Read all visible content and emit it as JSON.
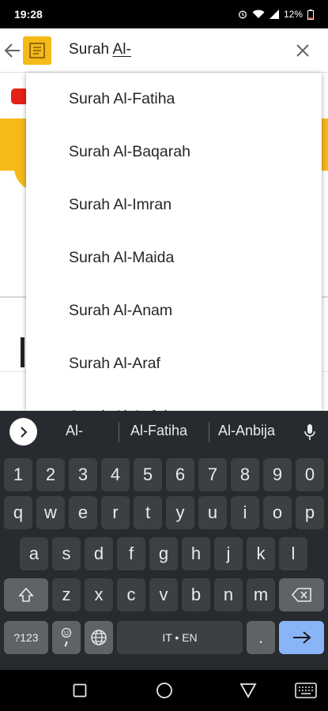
{
  "status": {
    "time": "19:28",
    "battery": "12%"
  },
  "search": {
    "prefix": "Surah ",
    "typed": "Al-"
  },
  "suggestions": [
    "Surah Al-Fatiha",
    "Surah Al-Baqarah",
    "Surah Al-Imran",
    "Surah Al-Maida",
    "Surah Al-Anam",
    "Surah Al-Araf",
    "Surah Al-Anfal"
  ],
  "keyboard": {
    "word_suggestions": [
      "Al-",
      "Al-Fatiha",
      "Al-Anbija"
    ],
    "number_row": [
      "1",
      "2",
      "3",
      "4",
      "5",
      "6",
      "7",
      "8",
      "9",
      "0"
    ],
    "row1": [
      "q",
      "w",
      "e",
      "r",
      "t",
      "y",
      "u",
      "i",
      "o",
      "p"
    ],
    "row2": [
      "a",
      "s",
      "d",
      "f",
      "g",
      "h",
      "j",
      "k",
      "l"
    ],
    "row3": [
      "z",
      "x",
      "c",
      "v",
      "b",
      "n",
      "m"
    ],
    "symbols_label": "?123",
    "space_label": "IT • EN",
    "period_label": "."
  },
  "colors": {
    "accent_yellow": "#f5b918",
    "keyboard_bg": "#272a2e",
    "key_bg": "#3c4043",
    "enter_blue": "#8ab4f8"
  }
}
